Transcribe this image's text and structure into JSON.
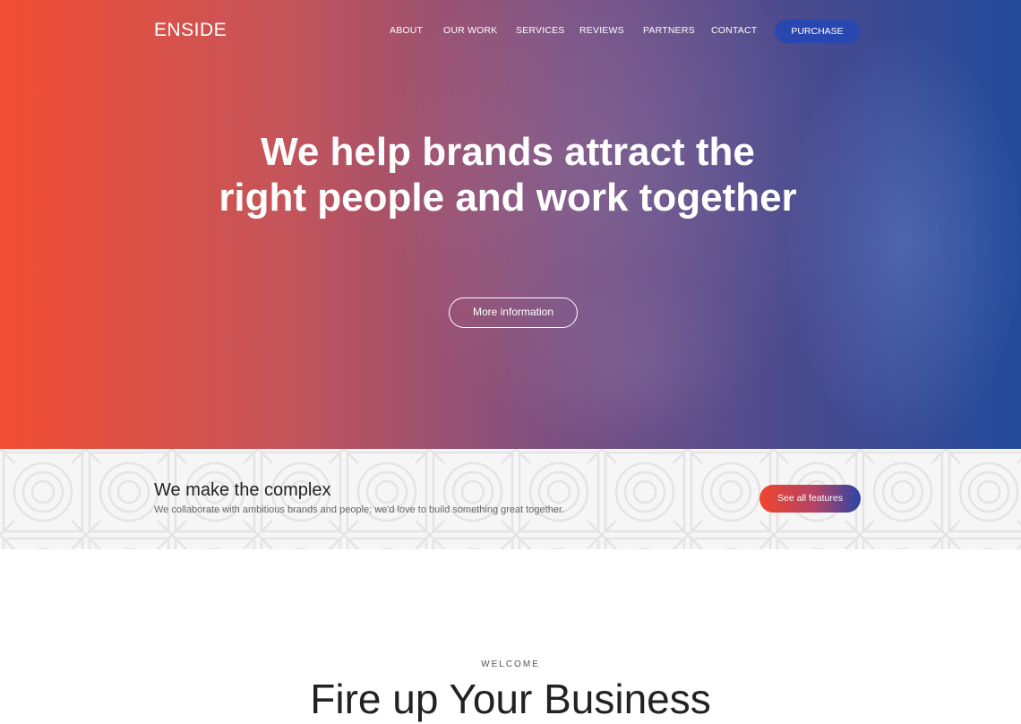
{
  "brand": {
    "logo_text": "ENSIDE"
  },
  "nav": {
    "items": [
      {
        "label": "ABOUT"
      },
      {
        "label": "OUR WORK"
      },
      {
        "label": "SERVICES"
      },
      {
        "label": "REVIEWS"
      },
      {
        "label": "PARTNERS"
      },
      {
        "label": "CONTACT"
      }
    ],
    "purchase_label": "PURCHASE"
  },
  "hero": {
    "title": "We help brands attract the right people and work together",
    "cta_label": "More information"
  },
  "features_band": {
    "title": "We make the complex",
    "subtitle": "We collaborate with ambitious brands and people; we'd love to build something great together.",
    "cta_label": "See all features"
  },
  "welcome": {
    "label": "WELCOME",
    "title": "Fire up Your Business"
  },
  "colors": {
    "hero_gradient_start": "#f24e33",
    "hero_gradient_end": "#234a99",
    "purchase_button": "#2847b0",
    "features_button_start": "#f0452c",
    "features_button_end": "#2b44a6"
  }
}
